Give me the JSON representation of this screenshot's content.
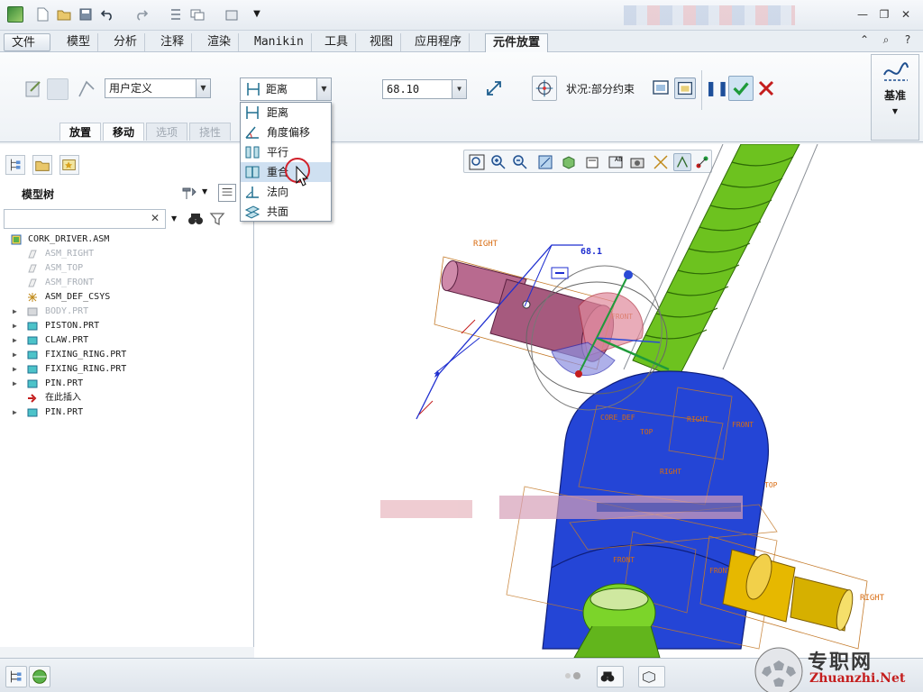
{
  "ribbon_tabs": {
    "file": "文件",
    "model": "模型",
    "analysis": "分析",
    "annotate": "注释",
    "render": "渲染",
    "manikin": "Manikin",
    "tools": "工具",
    "view": "视图",
    "apps": "应用程序",
    "placement": "元件放置"
  },
  "ribbon": {
    "constraint_set": "用户定义",
    "constraint_type": "距离",
    "offset_value": "68.10",
    "status": "状况:部分约束",
    "datum_label": "基准",
    "subtabs": {
      "placement": "放置",
      "move": "移动",
      "options": "选项",
      "flexibility": "挠性"
    }
  },
  "dropdown": {
    "items": [
      "距离",
      "角度偏移",
      "平行",
      "重合",
      "法向",
      "共面"
    ],
    "hovered_index": 3
  },
  "left_panel": {
    "title": "模型树"
  },
  "tree": [
    {
      "label": "CORK_DRIVER.ASM",
      "root": true,
      "dim": false,
      "expandable": false
    },
    {
      "label": "ASM_RIGHT",
      "dim": true,
      "expandable": false
    },
    {
      "label": "ASM_TOP",
      "dim": true,
      "expandable": false
    },
    {
      "label": "ASM_FRONT",
      "dim": true,
      "expandable": false
    },
    {
      "label": "ASM_DEF_CSYS",
      "dim": false,
      "expandable": false
    },
    {
      "label": "BODY.PRT",
      "dim": true,
      "expandable": true
    },
    {
      "label": "PISTON.PRT",
      "dim": false,
      "expandable": true
    },
    {
      "label": "CLAW.PRT",
      "dim": false,
      "expandable": true
    },
    {
      "label": "FIXING_RING.PRT",
      "dim": false,
      "expandable": true
    },
    {
      "label": "FIXING_RING.PRT",
      "dim": false,
      "expandable": true
    },
    {
      "label": "PIN.PRT",
      "dim": false,
      "expandable": true
    },
    {
      "label": "在此插入",
      "dim": false,
      "expandable": false
    },
    {
      "label": "PIN.PRT",
      "dim": false,
      "expandable": true
    }
  ],
  "viewport": {
    "dim_value": "68.1",
    "datum_labels": [
      "RIGHT",
      "FRONT",
      "TOP",
      "RIGHT",
      "FRONT",
      "TOP"
    ]
  },
  "watermark": {
    "cn": "专职网",
    "en": "Zhuanzhi.Net"
  }
}
